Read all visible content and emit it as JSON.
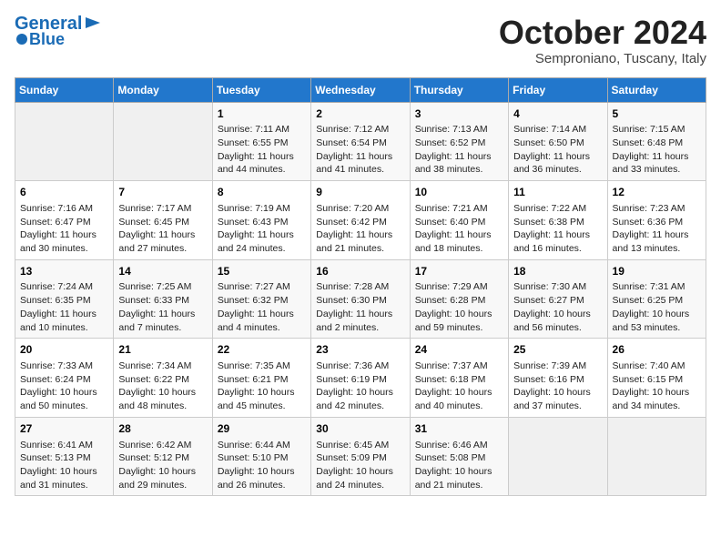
{
  "header": {
    "logo_line1": "General",
    "logo_line2": "Blue",
    "month": "October 2024",
    "location": "Semproniano, Tuscany, Italy"
  },
  "days_of_week": [
    "Sunday",
    "Monday",
    "Tuesday",
    "Wednesday",
    "Thursday",
    "Friday",
    "Saturday"
  ],
  "weeks": [
    [
      {
        "num": "",
        "text": ""
      },
      {
        "num": "",
        "text": ""
      },
      {
        "num": "1",
        "text": "Sunrise: 7:11 AM\nSunset: 6:55 PM\nDaylight: 11 hours and 44 minutes."
      },
      {
        "num": "2",
        "text": "Sunrise: 7:12 AM\nSunset: 6:54 PM\nDaylight: 11 hours and 41 minutes."
      },
      {
        "num": "3",
        "text": "Sunrise: 7:13 AM\nSunset: 6:52 PM\nDaylight: 11 hours and 38 minutes."
      },
      {
        "num": "4",
        "text": "Sunrise: 7:14 AM\nSunset: 6:50 PM\nDaylight: 11 hours and 36 minutes."
      },
      {
        "num": "5",
        "text": "Sunrise: 7:15 AM\nSunset: 6:48 PM\nDaylight: 11 hours and 33 minutes."
      }
    ],
    [
      {
        "num": "6",
        "text": "Sunrise: 7:16 AM\nSunset: 6:47 PM\nDaylight: 11 hours and 30 minutes."
      },
      {
        "num": "7",
        "text": "Sunrise: 7:17 AM\nSunset: 6:45 PM\nDaylight: 11 hours and 27 minutes."
      },
      {
        "num": "8",
        "text": "Sunrise: 7:19 AM\nSunset: 6:43 PM\nDaylight: 11 hours and 24 minutes."
      },
      {
        "num": "9",
        "text": "Sunrise: 7:20 AM\nSunset: 6:42 PM\nDaylight: 11 hours and 21 minutes."
      },
      {
        "num": "10",
        "text": "Sunrise: 7:21 AM\nSunset: 6:40 PM\nDaylight: 11 hours and 18 minutes."
      },
      {
        "num": "11",
        "text": "Sunrise: 7:22 AM\nSunset: 6:38 PM\nDaylight: 11 hours and 16 minutes."
      },
      {
        "num": "12",
        "text": "Sunrise: 7:23 AM\nSunset: 6:36 PM\nDaylight: 11 hours and 13 minutes."
      }
    ],
    [
      {
        "num": "13",
        "text": "Sunrise: 7:24 AM\nSunset: 6:35 PM\nDaylight: 11 hours and 10 minutes."
      },
      {
        "num": "14",
        "text": "Sunrise: 7:25 AM\nSunset: 6:33 PM\nDaylight: 11 hours and 7 minutes."
      },
      {
        "num": "15",
        "text": "Sunrise: 7:27 AM\nSunset: 6:32 PM\nDaylight: 11 hours and 4 minutes."
      },
      {
        "num": "16",
        "text": "Sunrise: 7:28 AM\nSunset: 6:30 PM\nDaylight: 11 hours and 2 minutes."
      },
      {
        "num": "17",
        "text": "Sunrise: 7:29 AM\nSunset: 6:28 PM\nDaylight: 10 hours and 59 minutes."
      },
      {
        "num": "18",
        "text": "Sunrise: 7:30 AM\nSunset: 6:27 PM\nDaylight: 10 hours and 56 minutes."
      },
      {
        "num": "19",
        "text": "Sunrise: 7:31 AM\nSunset: 6:25 PM\nDaylight: 10 hours and 53 minutes."
      }
    ],
    [
      {
        "num": "20",
        "text": "Sunrise: 7:33 AM\nSunset: 6:24 PM\nDaylight: 10 hours and 50 minutes."
      },
      {
        "num": "21",
        "text": "Sunrise: 7:34 AM\nSunset: 6:22 PM\nDaylight: 10 hours and 48 minutes."
      },
      {
        "num": "22",
        "text": "Sunrise: 7:35 AM\nSunset: 6:21 PM\nDaylight: 10 hours and 45 minutes."
      },
      {
        "num": "23",
        "text": "Sunrise: 7:36 AM\nSunset: 6:19 PM\nDaylight: 10 hours and 42 minutes."
      },
      {
        "num": "24",
        "text": "Sunrise: 7:37 AM\nSunset: 6:18 PM\nDaylight: 10 hours and 40 minutes."
      },
      {
        "num": "25",
        "text": "Sunrise: 7:39 AM\nSunset: 6:16 PM\nDaylight: 10 hours and 37 minutes."
      },
      {
        "num": "26",
        "text": "Sunrise: 7:40 AM\nSunset: 6:15 PM\nDaylight: 10 hours and 34 minutes."
      }
    ],
    [
      {
        "num": "27",
        "text": "Sunrise: 6:41 AM\nSunset: 5:13 PM\nDaylight: 10 hours and 31 minutes."
      },
      {
        "num": "28",
        "text": "Sunrise: 6:42 AM\nSunset: 5:12 PM\nDaylight: 10 hours and 29 minutes."
      },
      {
        "num": "29",
        "text": "Sunrise: 6:44 AM\nSunset: 5:10 PM\nDaylight: 10 hours and 26 minutes."
      },
      {
        "num": "30",
        "text": "Sunrise: 6:45 AM\nSunset: 5:09 PM\nDaylight: 10 hours and 24 minutes."
      },
      {
        "num": "31",
        "text": "Sunrise: 6:46 AM\nSunset: 5:08 PM\nDaylight: 10 hours and 21 minutes."
      },
      {
        "num": "",
        "text": ""
      },
      {
        "num": "",
        "text": ""
      }
    ]
  ]
}
